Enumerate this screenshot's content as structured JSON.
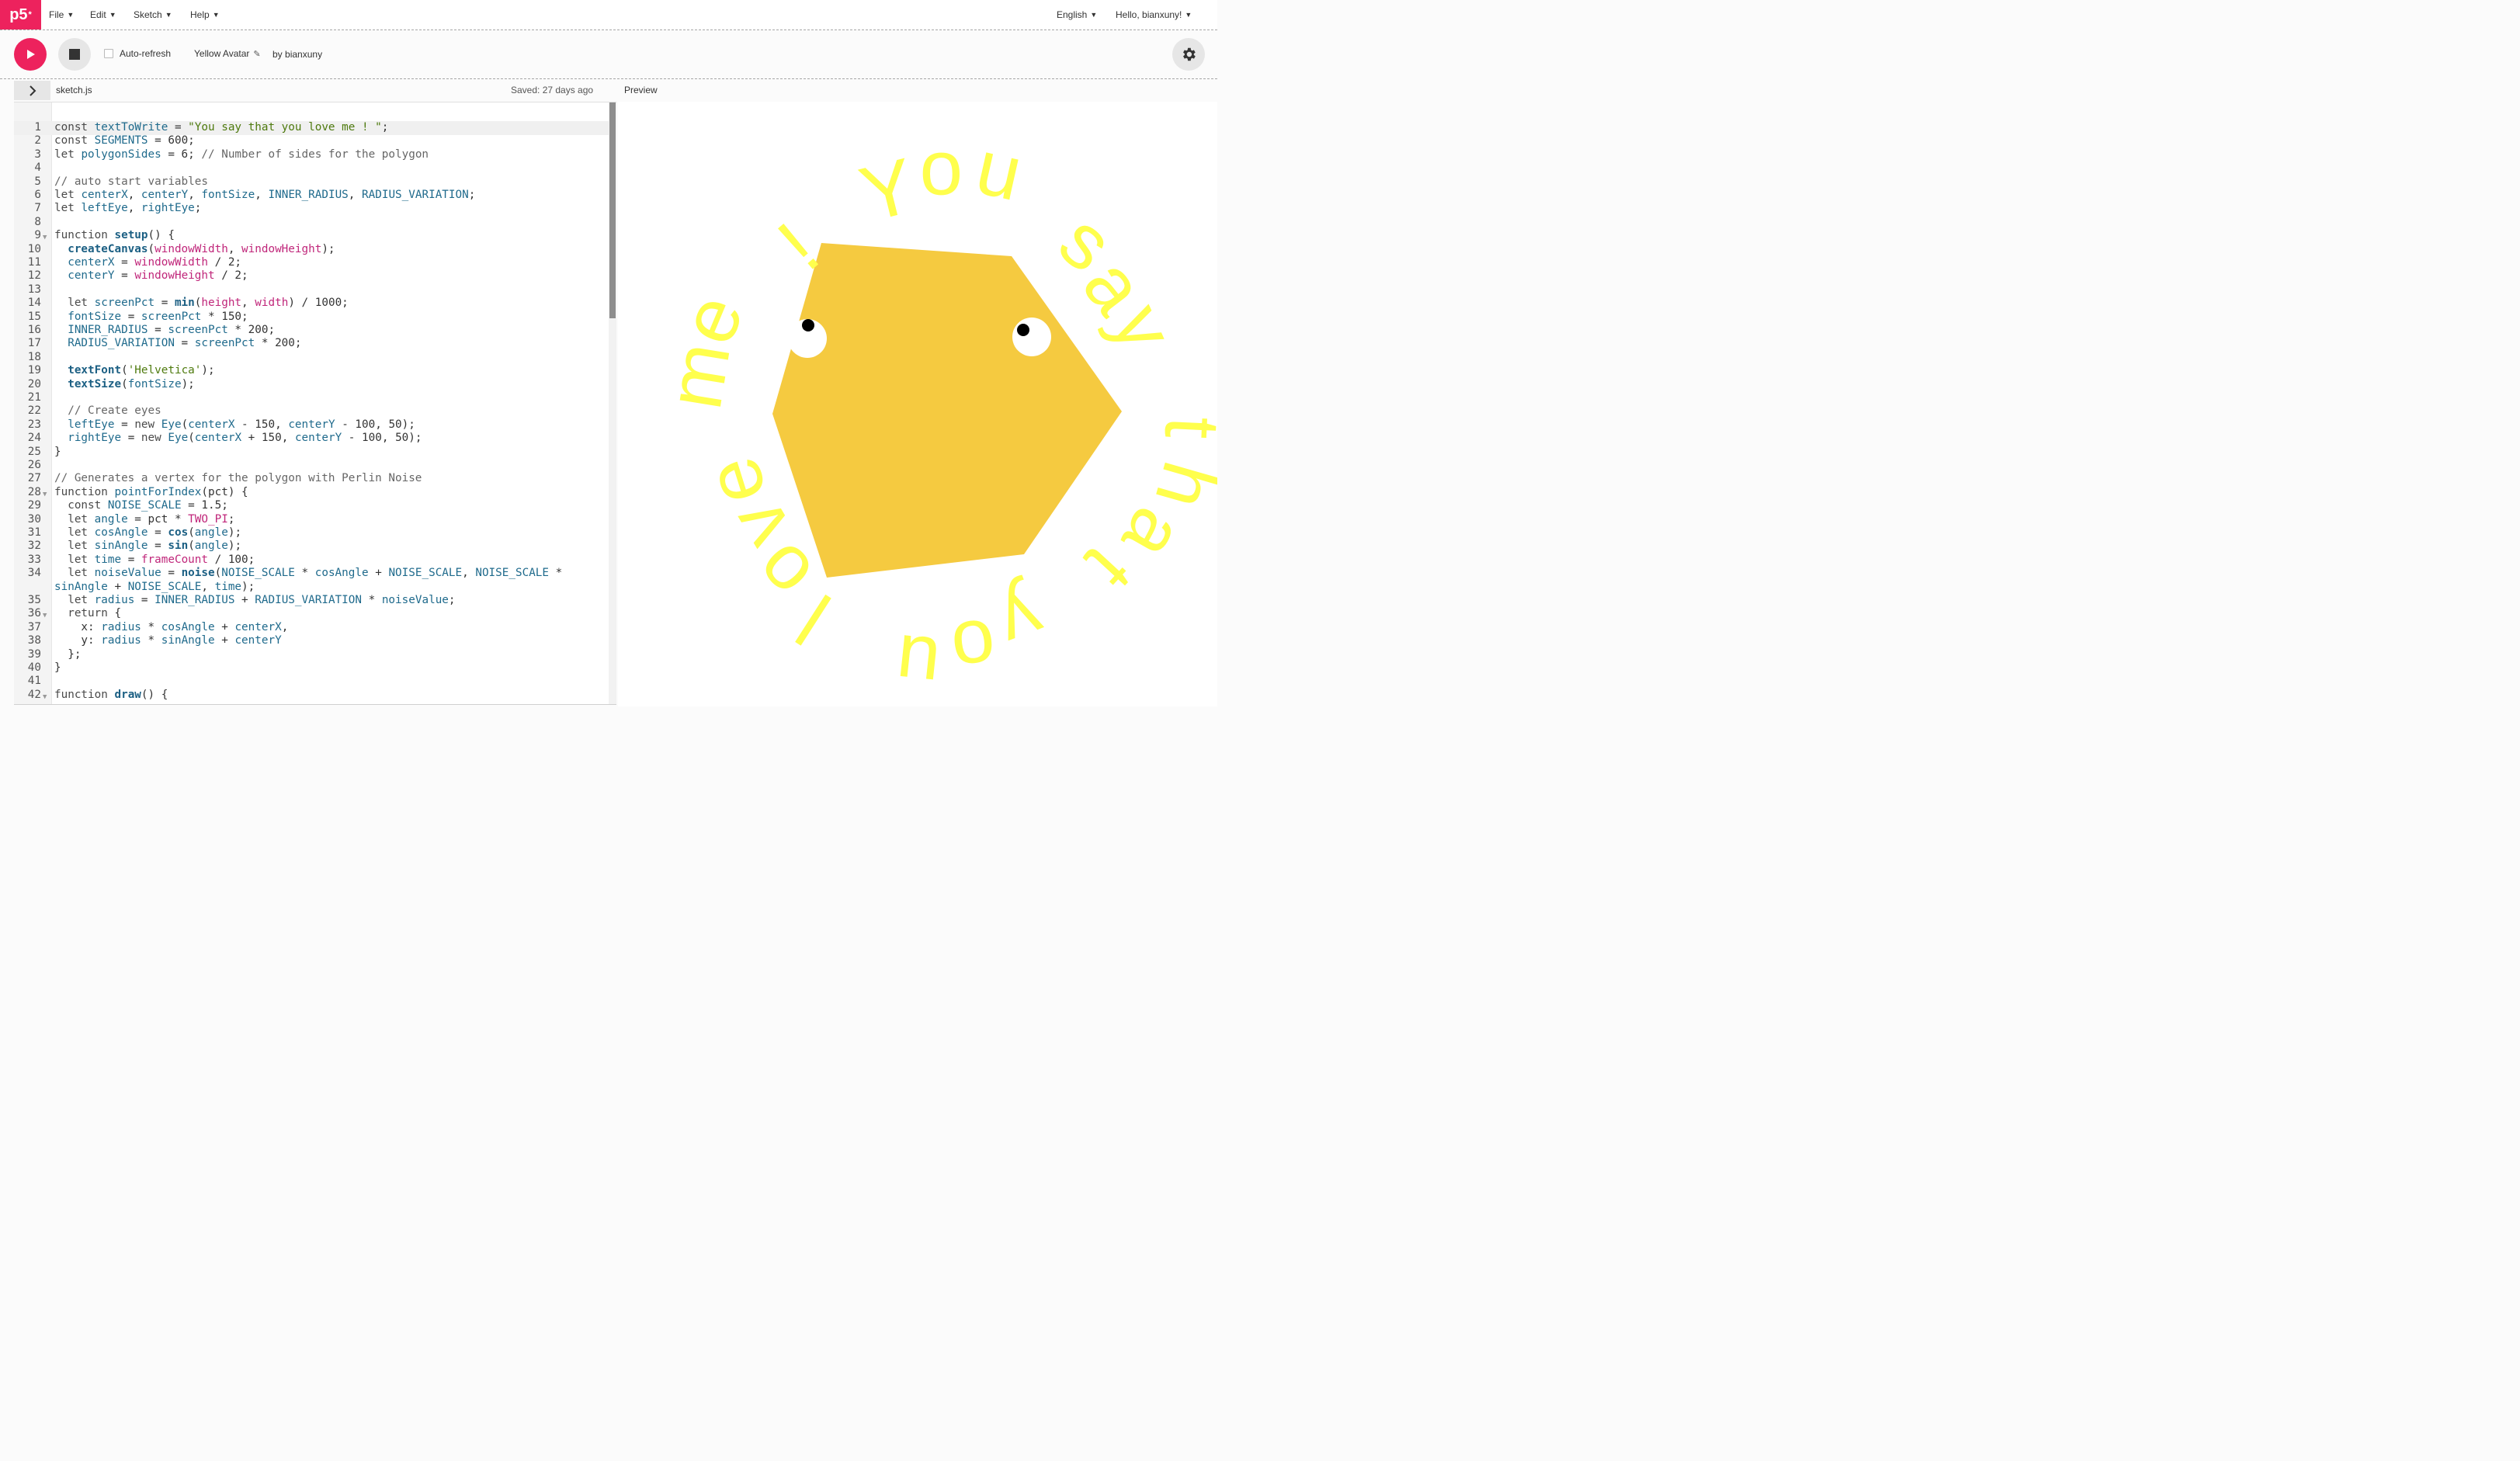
{
  "nav": {
    "logo": "p5",
    "logo_sup": "*",
    "menus": [
      "File",
      "Edit",
      "Sketch",
      "Help"
    ],
    "language": "English",
    "greeting": "Hello, bianxuny!"
  },
  "toolbar": {
    "auto_refresh_label": "Auto-refresh",
    "auto_refresh_checked": false,
    "sketch_name": "Yellow Avatar",
    "by_label": "by",
    "author": "bianxuny"
  },
  "editor": {
    "filename": "sketch.js",
    "saved_status": "Saved: 27 days ago",
    "preview_label": "Preview",
    "lines": [
      {
        "n": "1",
        "t": "const textToWrite = \"You say that you love me ! \";"
      },
      {
        "n": "2",
        "t": "const SEGMENTS = 600;"
      },
      {
        "n": "3",
        "t": "let polygonSides = 6; // Number of sides for the polygon"
      },
      {
        "n": "4",
        "t": ""
      },
      {
        "n": "5",
        "t": "// auto start variables"
      },
      {
        "n": "6",
        "t": "let centerX, centerY, fontSize, INNER_RADIUS, RADIUS_VARIATION;"
      },
      {
        "n": "7",
        "t": "let leftEye, rightEye;"
      },
      {
        "n": "8",
        "t": ""
      },
      {
        "n": "9",
        "t": "function setup() {",
        "fold": true
      },
      {
        "n": "10",
        "t": "  createCanvas(windowWidth, windowHeight);"
      },
      {
        "n": "11",
        "t": "  centerX = windowWidth / 2;"
      },
      {
        "n": "12",
        "t": "  centerY = windowHeight / 2;"
      },
      {
        "n": "13",
        "t": ""
      },
      {
        "n": "14",
        "t": "  let screenPct = min(height, width) / 1000;"
      },
      {
        "n": "15",
        "t": "  fontSize = screenPct * 150;"
      },
      {
        "n": "16",
        "t": "  INNER_RADIUS = screenPct * 200;"
      },
      {
        "n": "17",
        "t": "  RADIUS_VARIATION = screenPct * 200;"
      },
      {
        "n": "18",
        "t": ""
      },
      {
        "n": "19",
        "t": "  textFont('Helvetica');"
      },
      {
        "n": "20",
        "t": "  textSize(fontSize);"
      },
      {
        "n": "21",
        "t": ""
      },
      {
        "n": "22",
        "t": "  // Create eyes"
      },
      {
        "n": "23",
        "t": "  leftEye = new Eye(centerX - 150, centerY - 100, 50);"
      },
      {
        "n": "24",
        "t": "  rightEye = new Eye(centerX + 150, centerY - 100, 50);"
      },
      {
        "n": "25",
        "t": "}"
      },
      {
        "n": "26",
        "t": ""
      },
      {
        "n": "27",
        "t": "// Generates a vertex for the polygon with Perlin Noise"
      },
      {
        "n": "28",
        "t": "function pointForIndex(pct) {",
        "fold": true
      },
      {
        "n": "29",
        "t": "  const NOISE_SCALE = 1.5;"
      },
      {
        "n": "30",
        "t": "  let angle = pct * TWO_PI;"
      },
      {
        "n": "31",
        "t": "  let cosAngle = cos(angle);"
      },
      {
        "n": "32",
        "t": "  let sinAngle = sin(angle);"
      },
      {
        "n": "33",
        "t": "  let time = frameCount / 100;"
      },
      {
        "n": "34",
        "t": "  let noiseValue = noise(NOISE_SCALE * cosAngle + NOISE_SCALE, NOISE_SCALE *"
      },
      {
        "n": "",
        "t": "sinAngle + NOISE_SCALE, time);"
      },
      {
        "n": "35",
        "t": "  let radius = INNER_RADIUS + RADIUS_VARIATION * noiseValue;"
      },
      {
        "n": "36",
        "t": "  return {",
        "fold": true
      },
      {
        "n": "37",
        "t": "    x: radius * cosAngle + centerX,"
      },
      {
        "n": "38",
        "t": "    y: radius * sinAngle + centerY"
      },
      {
        "n": "39",
        "t": "  };"
      },
      {
        "n": "40",
        "t": "}"
      },
      {
        "n": "41",
        "t": ""
      },
      {
        "n": "42",
        "t": "function draw() {",
        "fold": true
      }
    ]
  },
  "preview": {
    "ring_text": "You say that you love me ! ",
    "polygon_color": "#f5ca40",
    "text_color": "#ffff4d",
    "eye_white": "#ffffff",
    "pupil_color": "#000000"
  },
  "colors": {
    "accent": "#ed225d",
    "button_gray": "#e6e6e6"
  },
  "icons": {
    "play": "play-icon",
    "stop": "stop-icon",
    "settings": "gear-icon",
    "sidebar": "chevron-right-icon",
    "edit": "pencil-icon"
  }
}
